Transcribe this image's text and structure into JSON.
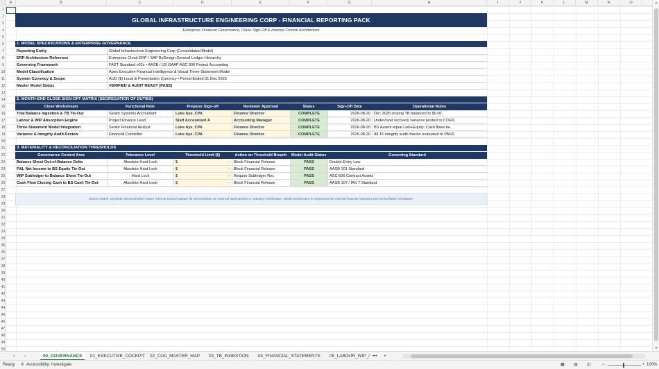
{
  "columns": [
    "A",
    "B",
    "C",
    "D",
    "E",
    "F",
    "G",
    "H",
    "I",
    "J",
    "K",
    "L",
    "M",
    "N",
    "O"
  ],
  "title": "GLOBAL INFRASTRUCTURE ENGINEERING CORP - FINANCIAL REPORTING PACK",
  "subtitle": "Enterprise Financial Governance, Close Sign-Off & Internal Control Architecture",
  "section1": {
    "header": "1. MODEL SPECIFICATIONS & ENTERPRISE GOVERNANCE",
    "rows": [
      {
        "label": "Reporting Entity",
        "value": "Global Infrastructure Engineering Corp (Consolidated Model)"
      },
      {
        "label": "ERP Architecture Reference",
        "value": "Enterprise Cloud ERP / SAP ByDesign General Ledger Hierarchy"
      },
      {
        "label": "Governing Framework",
        "value": "FAST Standard v02c • AASB / US GAAP ASC 606 Project Accounting"
      },
      {
        "label": "Model Classification",
        "value": "Apex Executive Financial Intelligence & Visual Three-Statement Model"
      },
      {
        "label": "System Currency & Scope",
        "value": "AUD ($) Local & Presentation Currency • Period Ended 31 Dec 2025"
      },
      {
        "label": "Master Model Status",
        "value": "VERIFIED & AUDIT READY [PASS]"
      }
    ]
  },
  "section2": {
    "header": "2. MONTH-END CLOSE SIGN-OFF MATRIX (SEGREGATION OF DUTIES)",
    "columns": [
      "Close Workstream",
      "Functional Role",
      "Preparer Sign-off",
      "Reviewer Approval",
      "Status",
      "Sign-Off Date",
      "Operational Notes"
    ],
    "rows": [
      {
        "workstream": "Trial Balance Ingestion & TB Tie-Out",
        "role": "Senior Systems Accountant",
        "preparer": "Luke Aye, CPA",
        "reviewer": "Finance Director",
        "status": "COMPLETE",
        "date": "2026-08-20",
        "notes": "Dec 2025 closing TB balanced to $0.00."
      },
      {
        "workstream": "Labour & WIP Absorption Engine",
        "role": "Project Finance Lead",
        "preparer": "Staff Accountant A",
        "reviewer": "Accounting Manager",
        "status": "COMPLETE",
        "date": "2026-08-20",
        "notes": "Under/over recovery variance posted to COGS."
      },
      {
        "workstream": "Three-Statement Model Integration",
        "role": "Senior Financial Analyst",
        "preparer": "Luke Aye, CPA",
        "reviewer": "Finance Director",
        "status": "COMPLETE",
        "date": "2026-08-20",
        "notes": "BS Assets equal Liab+Equity; Cash flows tie."
      },
      {
        "workstream": "Variance & Integrity Audit Review",
        "role": "Financial Controller",
        "preparer": "Luke Aye, CPA",
        "reviewer": "Finance Director",
        "status": "COMPLETE",
        "date": "2026-08-20",
        "notes": "All 15 integrity audit checks evaluated to PASS."
      }
    ]
  },
  "section3": {
    "header": "3. MATERIALITY & RECONCILIATION THRESHOLDS",
    "columns": [
      "Governance Control Area",
      "Tolerance Level",
      "Threshold Limit ($)",
      "Action on Threshold Breach",
      "Model Audit Status",
      "Governing Standard"
    ],
    "rows": [
      {
        "area": "Balance Sheet Out-of-Balance Delta",
        "tolerance": "Absolute Hard Lock",
        "currency": "$",
        "limit": "-",
        "action": "Block Financial Release",
        "status": "PASS",
        "standard": "Double-Entry Law"
      },
      {
        "area": "P&L Net Income to BS Equity Tie-Out",
        "tolerance": "Absolute Hard Lock",
        "currency": "$",
        "limit": "-",
        "action": "Block Financial Release",
        "status": "PASS",
        "standard": "AASB 101 Standard"
      },
      {
        "area": "WIP Subledger to Balance Sheet Tie-Out",
        "tolerance": "Hard Lock",
        "currency": "$",
        "limit": "-",
        "action": "Require Subledger Rec",
        "status": "PASS",
        "standard": "ASC 606 Contract Assets"
      },
      {
        "area": "Cash Flow Closing Cash to BS Cash Tie-Out",
        "tolerance": "Absolute Hard Lock",
        "currency": "$",
        "limit": "-",
        "action": "Block Financial Release",
        "status": "PASS",
        "standard": "AASB 107 / IAS 7 Standard"
      }
    ]
  },
  "disclaimer": "DISCLAIMER: Synthetic demonstration model. Internal control outputs do not constitute an external audit opinion or statutory certification. Model architecture is engineered for internal financial reporting and reconciliation simulation.",
  "tabs": [
    "00_GOVERNANCE",
    "01_EXECUTIVE_COCKPIT",
    "02_COA_MASTER_MAP",
    "03_TB_INGESTION",
    "04_FINANCIAL_STATEMENTS",
    "05_LABOUR_WIP_/"
  ],
  "tab_more": "•••",
  "tab_add": "+",
  "status": {
    "ready": "Ready",
    "accessibility": "Accessibility: Investigate",
    "zoom": "100%"
  },
  "colors": {
    "navy": "#1f3864",
    "excel_green": "#1b7340"
  }
}
